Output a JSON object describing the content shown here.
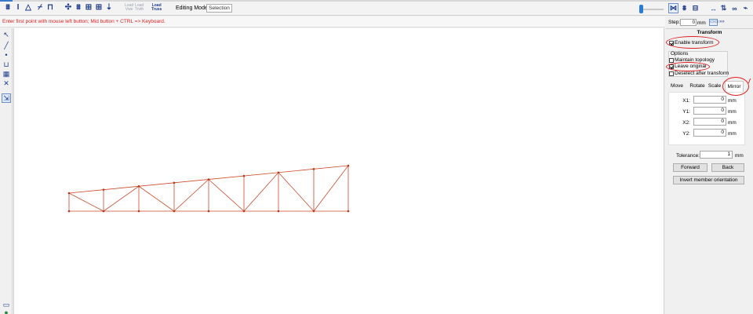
{
  "toolbar": {
    "left_icons": [
      {
        "name": "truss-icon",
        "glyph": "⩩"
      },
      {
        "name": "beam-i-icon",
        "glyph": "I"
      },
      {
        "name": "triangle-icon",
        "glyph": "△"
      },
      {
        "name": "zigzag-icon",
        "glyph": "⌿"
      },
      {
        "name": "frame-icon",
        "glyph": "⊓"
      },
      {
        "name": "node-arrows-icon",
        "glyph": "✣"
      },
      {
        "name": "node-group-icon",
        "glyph": "⩩"
      },
      {
        "name": "grid-icon",
        "glyph": "⊞"
      },
      {
        "name": "grid-table-icon",
        "glyph": "⊞"
      },
      {
        "name": "arrow-down-icon",
        "glyph": "⇣"
      }
    ],
    "load_buttons": [
      {
        "line1": "Load",
        "line2": "Vwe",
        "strong": false
      },
      {
        "line1": "Load",
        "line2": "Trvth",
        "strong": false
      },
      {
        "line1": "Load",
        "line2": "Truss",
        "strong": true
      }
    ],
    "editing_mode_label": "Editing Mode:",
    "editing_mode_value": "Selection",
    "right_icons": [
      {
        "name": "snap-node-icon",
        "glyph": "⋈",
        "active": true
      },
      {
        "name": "snap-grid-icon",
        "glyph": "⩩",
        "active": false
      },
      {
        "name": "snap-ortho-icon",
        "glyph": "⊟",
        "active": false
      },
      {
        "name": "dimension-icon",
        "glyph": "↔",
        "active": false
      },
      {
        "name": "dimension-vertical-icon",
        "glyph": "⇅",
        "active": false
      },
      {
        "name": "view-glasses-icon",
        "glyph": "∞",
        "active": false
      },
      {
        "name": "line-style-icon",
        "glyph": "⌁",
        "active": false
      }
    ]
  },
  "status": {
    "message": "Enter first point with mouse left button; Mid button + CTRL => Keyboard."
  },
  "left_tools": [
    {
      "name": "select-arrow-icon",
      "glyph": "↖",
      "active": false
    },
    {
      "name": "draw-line-icon",
      "glyph": "╱",
      "active": false
    },
    {
      "name": "point-icon",
      "glyph": "•",
      "active": false
    },
    {
      "name": "support-icon",
      "glyph": "⊔",
      "active": false
    },
    {
      "name": "truss-tool-icon",
      "glyph": "▦",
      "active": false
    },
    {
      "name": "delete-icon",
      "glyph": "✕",
      "active": false
    },
    {
      "name": "transform-tool-icon",
      "glyph": "⇲",
      "active": true
    }
  ],
  "left_bottom_tools": [
    {
      "name": "monitor-icon",
      "glyph": "▭"
    },
    {
      "name": "globe-icon",
      "glyph": "●"
    }
  ],
  "panel": {
    "step_label": "Step:",
    "step_value": "0",
    "step_unit": "mm",
    "step_button": "▭▭",
    "step_button2": "»»",
    "title": "Transform",
    "enable_transform": {
      "label": "Enable transform",
      "checked": true
    },
    "options_label": "Options",
    "options": [
      {
        "label": "Maintain topology",
        "checked": false
      },
      {
        "label": "Leave original",
        "checked": true
      },
      {
        "label": "Deselect after transform",
        "checked": false
      }
    ],
    "tabs": [
      {
        "label": "Move",
        "active": false
      },
      {
        "label": "Rotate",
        "active": false
      },
      {
        "label": "Scale",
        "active": false
      },
      {
        "label": "Mirror",
        "active": true
      }
    ],
    "coords": [
      {
        "label": "X1:",
        "value": "0",
        "unit": "mm"
      },
      {
        "label": "Y1:",
        "value": "0",
        "unit": "mm"
      },
      {
        "label": "X2:",
        "value": "0",
        "unit": "mm"
      },
      {
        "label": "Y2:",
        "value": "0",
        "unit": "mm"
      }
    ],
    "tolerance_label": "Tolerance:",
    "tolerance_value": "1",
    "tolerance_unit": "mm",
    "forward_label": "Forward",
    "back_label": "Back",
    "invert_label": "Invert member orientation"
  },
  "colors": {
    "truss_line": "#cc4a2a",
    "truss_node": "#b03a1a",
    "annotation": "#e02020",
    "status_text": "#e02020"
  }
}
